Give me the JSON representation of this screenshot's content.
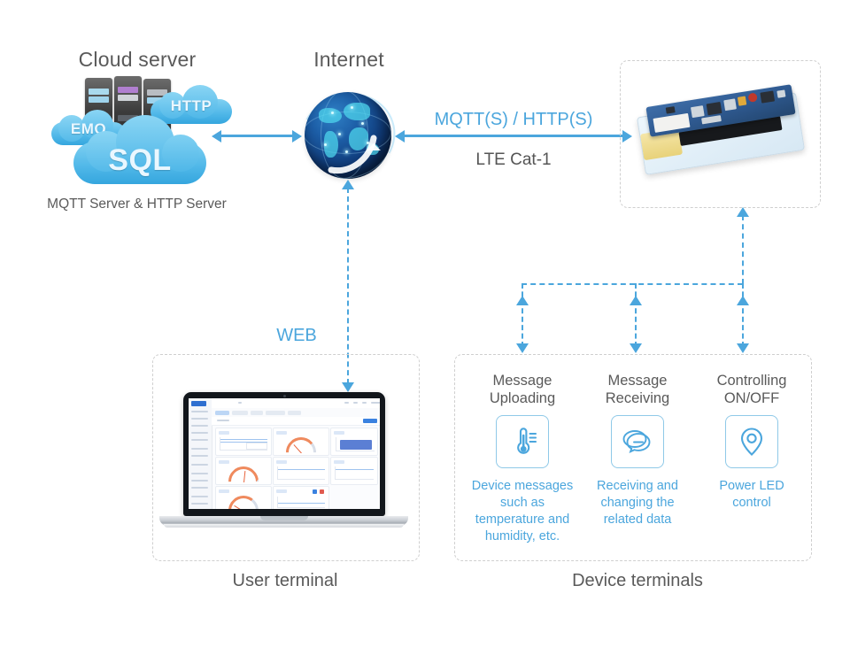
{
  "diagram": {
    "cloud": {
      "title": "Cloud server",
      "caption": "MQTT Server & HTTP Server",
      "cloud_labels": [
        "EMQ",
        "HTTP",
        "SQL"
      ]
    },
    "internet": {
      "title": "Internet",
      "icon": "globe-icon"
    },
    "links": {
      "cloud_to_internet": "",
      "internet_to_device_primary": "MQTT(S) / HTTP(S)",
      "internet_to_device_secondary": "LTE Cat-1",
      "internet_to_user": "WEB"
    },
    "user_terminal": {
      "caption": "User terminal",
      "device": "laptop-dashboard"
    },
    "device_terminals": {
      "caption": "Device terminals",
      "hardware": "iot-board-photo",
      "features": [
        {
          "title_line1": "Message",
          "title_line2": "Uploading",
          "icon": "thermometer-icon",
          "description": "Device messages such as temperature and humidity, etc."
        },
        {
          "title_line1": "Message",
          "title_line2": "Receiving",
          "icon": "chat-bubbles-icon",
          "description": "Receiving and changing the related data"
        },
        {
          "title_line1": "Controlling",
          "title_line2": "ON/OFF",
          "icon": "location-pin-icon",
          "description": "Power LED control"
        }
      ]
    },
    "colors": {
      "accent_blue": "#4ba6dd",
      "text_gray": "#5a5a5a",
      "panel_border": "#cfcfcf",
      "cloud_blue": "#4fb7e8"
    }
  }
}
